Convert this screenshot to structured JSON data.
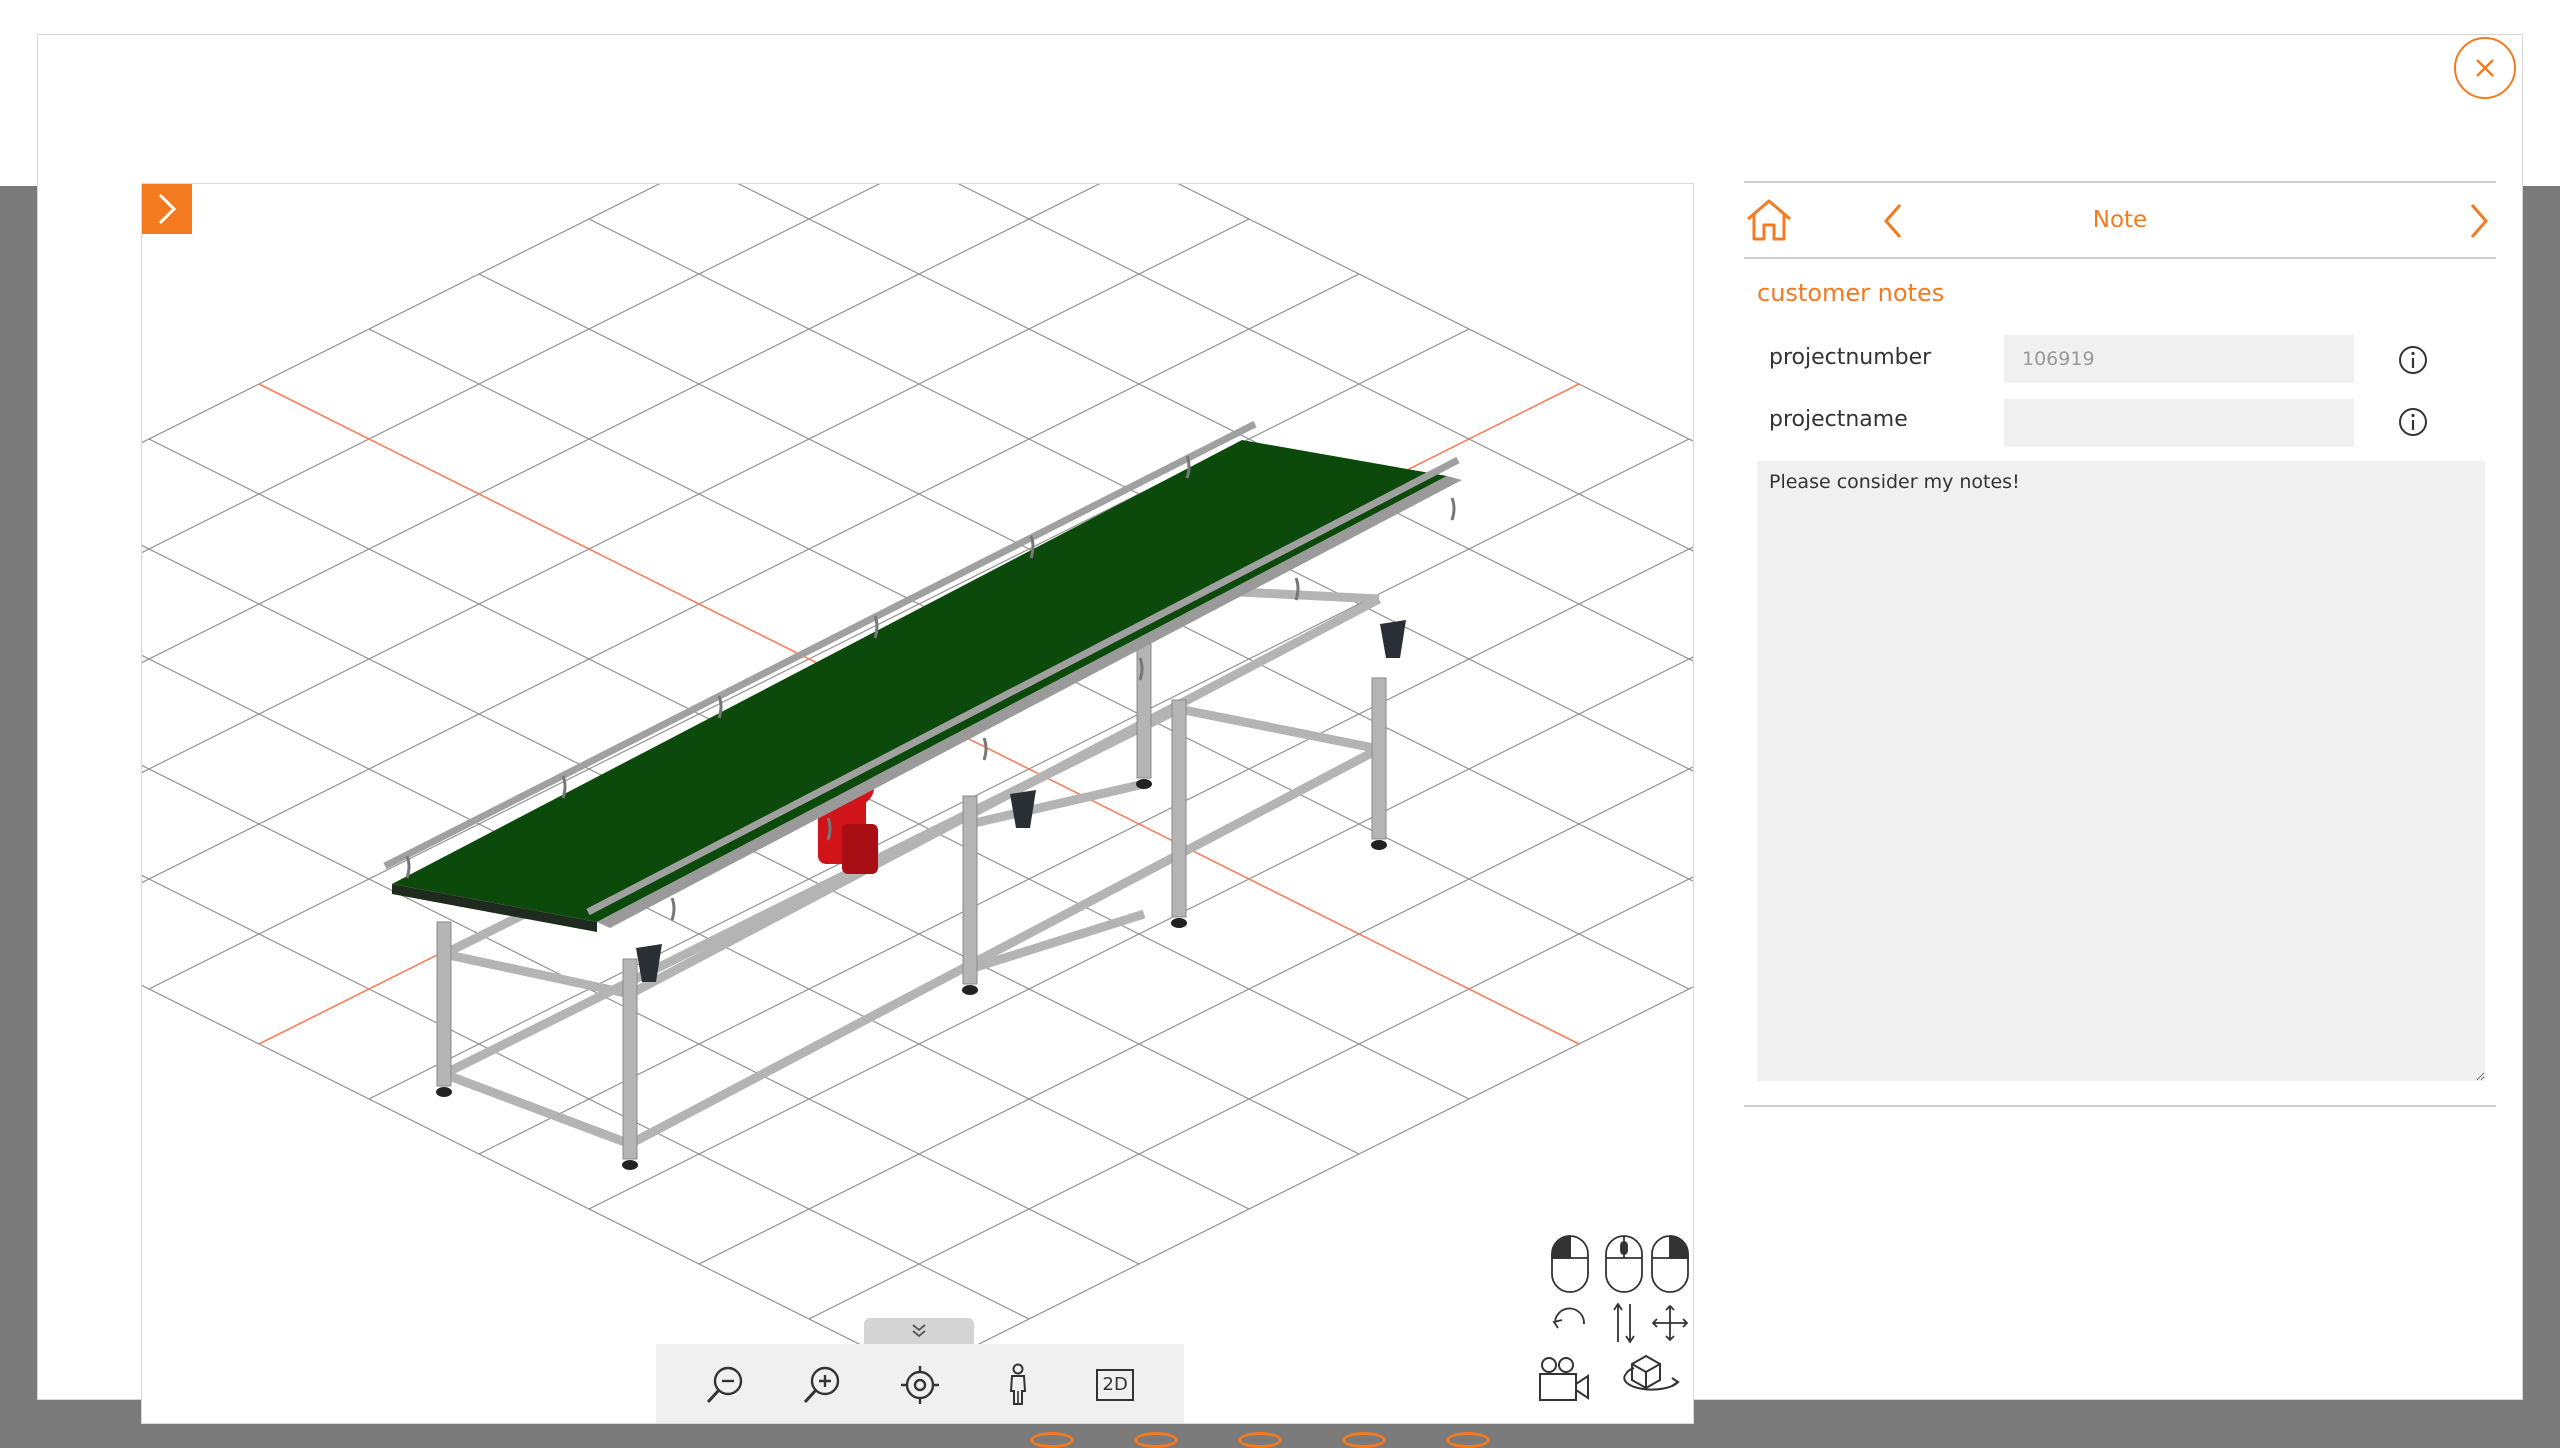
{
  "panel": {
    "title": "Note",
    "section_title": "customer notes",
    "fields": [
      {
        "label": "projectnumber",
        "value": "106919",
        "placeholder": ""
      },
      {
        "label": "projectname",
        "value": "",
        "placeholder": ""
      }
    ],
    "notes_text": "Please consider my notes!"
  },
  "viewer_toolbar": {
    "tools": [
      "zoom-out-icon",
      "zoom-in-icon",
      "target-icon",
      "person-icon"
    ],
    "view_2d_label": "2D"
  },
  "colors": {
    "accent": "#f47a20",
    "belt": "#0c4a0c",
    "motor": "#d0141a",
    "frame": "#b4b4b4",
    "grid": "#8c8c8c",
    "axis": "#ff7b5c"
  }
}
